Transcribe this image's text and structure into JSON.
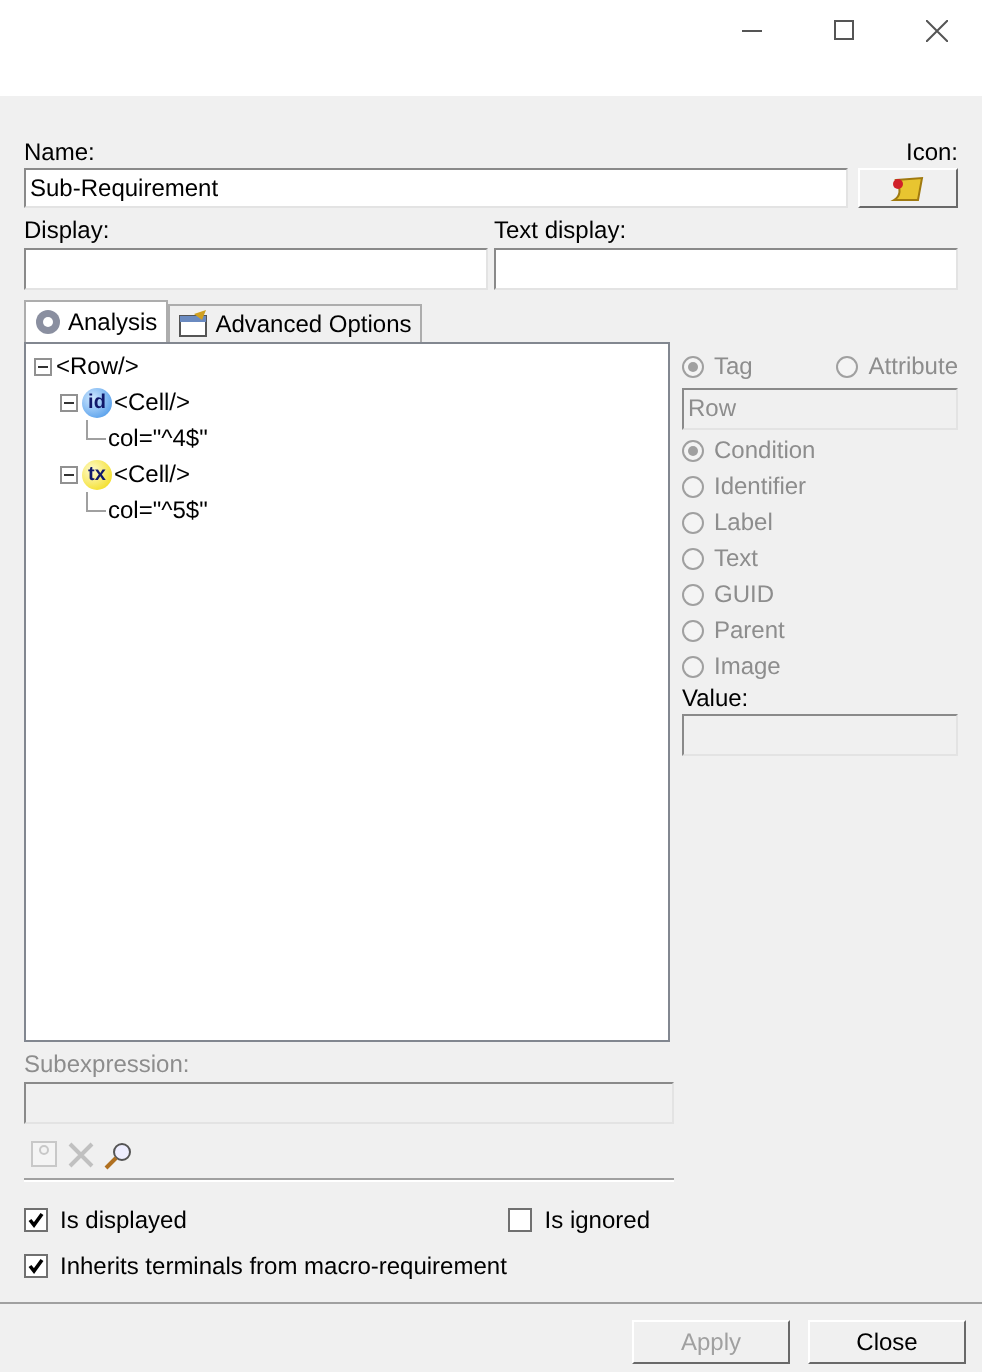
{
  "name_field": {
    "label": "Name:",
    "value": "Sub-Requirement"
  },
  "icon_field": {
    "label": "Icon:"
  },
  "display_field": {
    "label": "Display:"
  },
  "text_display_field": {
    "label": "Text display:"
  },
  "tabs": [
    {
      "label": "Analysis",
      "kind": "gear",
      "selected": true
    },
    {
      "label": "Advanced Options",
      "kind": "options",
      "selected": false
    }
  ],
  "tree": [
    {
      "label": "<Row/>",
      "expanded": true,
      "children": [
        {
          "label": "<Cell/>",
          "badge": "id",
          "kind": "blue",
          "expanded": true,
          "children": [
            {
              "label": "col=\"^4$\""
            }
          ]
        },
        {
          "label": "<Cell/>",
          "badge": "tx",
          "kind": "yellow",
          "expanded": true,
          "children": [
            {
              "label": "col=\"^5$\""
            }
          ]
        }
      ]
    }
  ],
  "node_panel": {
    "disabled": true,
    "type_options": [
      {
        "label": "Tag",
        "selected": true
      },
      {
        "label": "Attribute",
        "selected": false
      }
    ],
    "name_value": "Row",
    "match_options": [
      {
        "label": "Condition",
        "selected": true
      },
      {
        "label": "Identifier",
        "selected": false
      },
      {
        "label": "Label",
        "selected": false
      },
      {
        "label": "Text",
        "selected": false
      },
      {
        "label": "GUID",
        "selected": false
      },
      {
        "label": "Parent",
        "selected": false
      },
      {
        "label": "Image",
        "selected": false
      }
    ],
    "value_label": "Value:"
  },
  "subexpression": {
    "label": "Subexpression:",
    "disabled": true
  },
  "checkboxes": [
    {
      "label": "Is displayed",
      "checked": true
    },
    {
      "label": "Is ignored",
      "checked": false
    },
    {
      "label": "Inherits terminals from macro-requirement",
      "checked": true
    }
  ],
  "buttons": [
    {
      "label": "Apply",
      "disabled": true
    },
    {
      "label": "Close",
      "disabled": false
    }
  ]
}
